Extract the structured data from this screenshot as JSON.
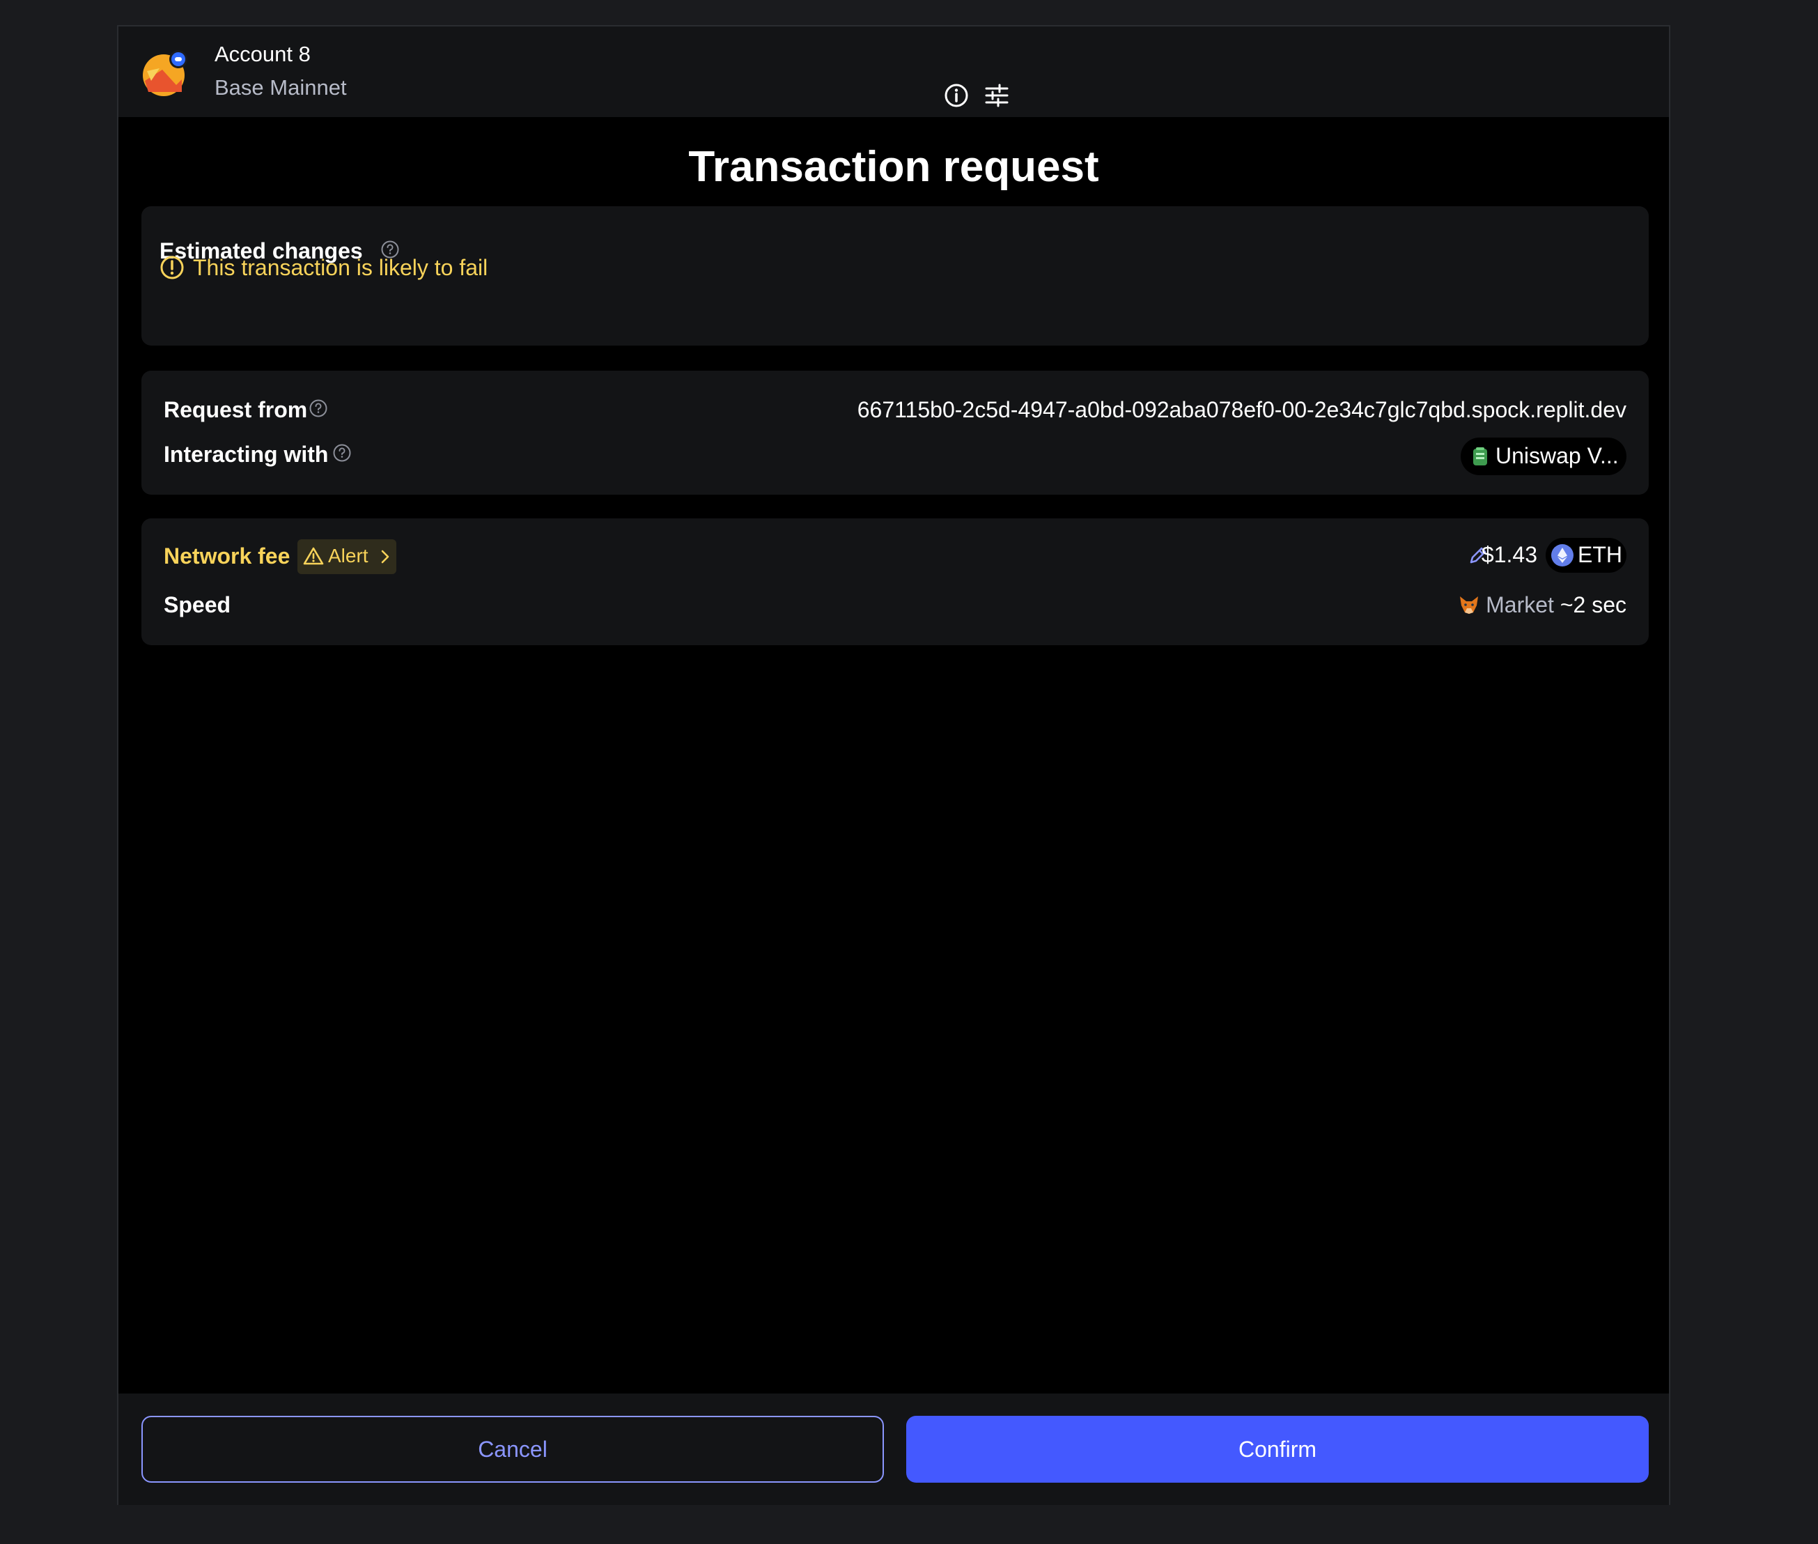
{
  "header": {
    "account_name": "Account 8",
    "network": "Base Mainnet",
    "icons": [
      "account-avatar",
      "info-icon",
      "settings-sliders-icon"
    ]
  },
  "title": "Transaction request",
  "estimated_changes": {
    "label": "Estimated changes",
    "warning": "This transaction is likely to fail"
  },
  "request": {
    "from_label": "Request from",
    "from_value": "667115b0-2c5d-4947-a0bd-092aba078ef0-00-2e34c7glc7qbd.spock.replit.dev",
    "interacting_label": "Interacting with",
    "interacting_value": "Uniswap V..."
  },
  "fee": {
    "label": "Network fee",
    "alert_label": "Alert",
    "amount": "$1.43",
    "currency": "ETH",
    "speed_label": "Speed",
    "speed_name": "Market",
    "speed_time": "~2 sec"
  },
  "footer": {
    "cancel_label": "Cancel",
    "confirm_label": "Confirm"
  },
  "colors": {
    "warning": "#f8d35a",
    "primary": "#4459ff",
    "cancel_outline": "#8b96ff",
    "card_bg": "#131416"
  }
}
